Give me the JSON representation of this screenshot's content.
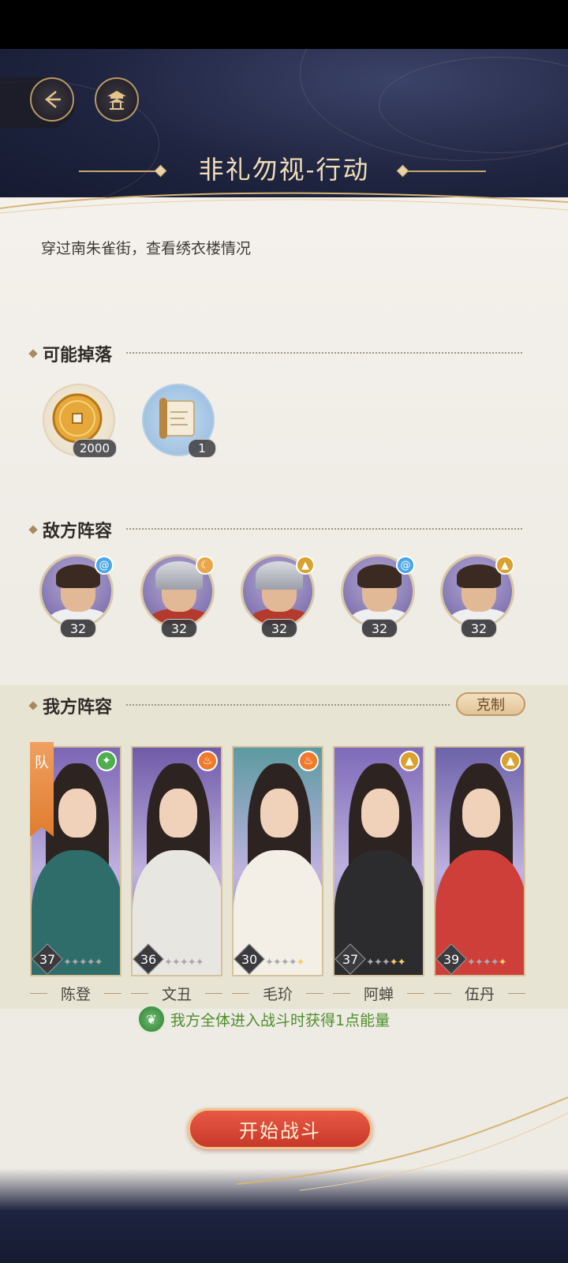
{
  "header": {
    "title": "非礼勿视-行动",
    "back_icon": "back-arrow-icon",
    "home_icon": "pavilion-icon"
  },
  "stage": {
    "description": "穿过南朱雀街，查看绣衣楼情况"
  },
  "drops": {
    "section_title": "可能掉落",
    "items": [
      {
        "icon": "coin-icon",
        "count": "2000"
      },
      {
        "icon": "scroll-icon",
        "count": "1"
      }
    ]
  },
  "enemies": {
    "section_title": "敌方阵容",
    "members": [
      {
        "level": "32",
        "element": "spiral",
        "element_color": "#4aa6e8",
        "type": "civilian"
      },
      {
        "level": "32",
        "element": "moon",
        "element_color": "#e9a64a",
        "type": "soldier"
      },
      {
        "level": "32",
        "element": "mountain",
        "element_color": "#d9a12e",
        "type": "soldier"
      },
      {
        "level": "32",
        "element": "spiral",
        "element_color": "#4aa6e8",
        "type": "civilian"
      },
      {
        "level": "32",
        "element": "mountain",
        "element_color": "#d9a12e",
        "type": "civilian"
      }
    ]
  },
  "team": {
    "section_title": "我方阵容",
    "counter_label": "克制",
    "leader_tag": "队",
    "members": [
      {
        "name": "陈登",
        "level": "37",
        "element_color": "#4fae50",
        "element_glyph": "✦",
        "stars_gold": 0,
        "stars_total": 5,
        "bg": "#7c66b5",
        "outfit": "#2f6d6b"
      },
      {
        "name": "文丑",
        "level": "36",
        "element_color": "#f07a2a",
        "element_glyph": "♨",
        "stars_gold": 0,
        "stars_total": 5,
        "bg": "#6f5aa8",
        "outfit": "#e8e6e0"
      },
      {
        "name": "毛玠",
        "level": "30",
        "element_color": "#f07a2a",
        "element_glyph": "♨",
        "stars_gold": 1,
        "stars_total": 5,
        "bg": "#5c9aa0",
        "outfit": "#f3efe6"
      },
      {
        "name": "阿蝉",
        "level": "37",
        "element_color": "#d9a12e",
        "element_glyph": "▲",
        "stars_gold": 2,
        "stars_total": 5,
        "bg": "#7e6ab8",
        "outfit": "#2c2b2e"
      },
      {
        "name": "伍丹",
        "level": "39",
        "element_color": "#d9a12e",
        "element_glyph": "▲",
        "stars_gold": 1,
        "stars_total": 5,
        "bg": "#6c62a8",
        "outfit": "#cf3f3a"
      }
    ],
    "bonus_text": "我方全体进入战斗时获得1点能量"
  },
  "actions": {
    "start_label": "开始战斗"
  }
}
